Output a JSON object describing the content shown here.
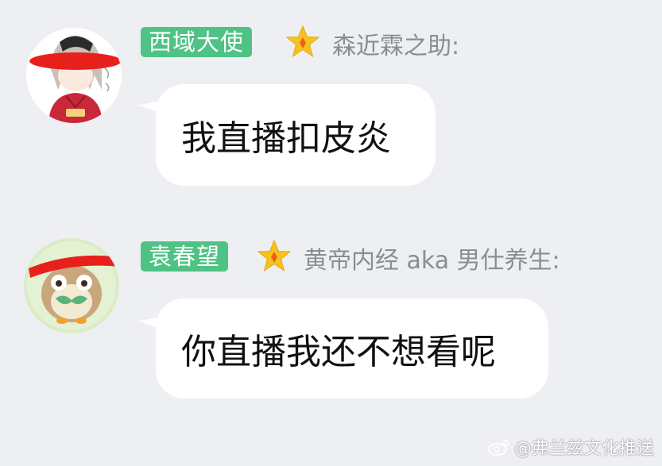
{
  "messages": [
    {
      "badge": "西域大使",
      "nickname": "森近霖之助:",
      "text": "我直播扣皮炎",
      "avatar_icon": "anime-girl-avatar",
      "badge_icon": "star-icon"
    },
    {
      "badge": "袁春望",
      "nickname": "黄帝内经 aka 男仕养生:",
      "text": "你直播我还不想看呢",
      "avatar_icon": "owl-avatar",
      "badge_icon": "star-icon"
    }
  ],
  "watermark": {
    "text": "@弗兰兹文化推送",
    "icon": "weibo-icon"
  },
  "colors": {
    "background": "#eeeff3",
    "badge": "#4fc285",
    "nickname": "#8a8d93",
    "bubble": "#ffffff",
    "redaction": "#e8201c",
    "star": "#f6c21c"
  }
}
